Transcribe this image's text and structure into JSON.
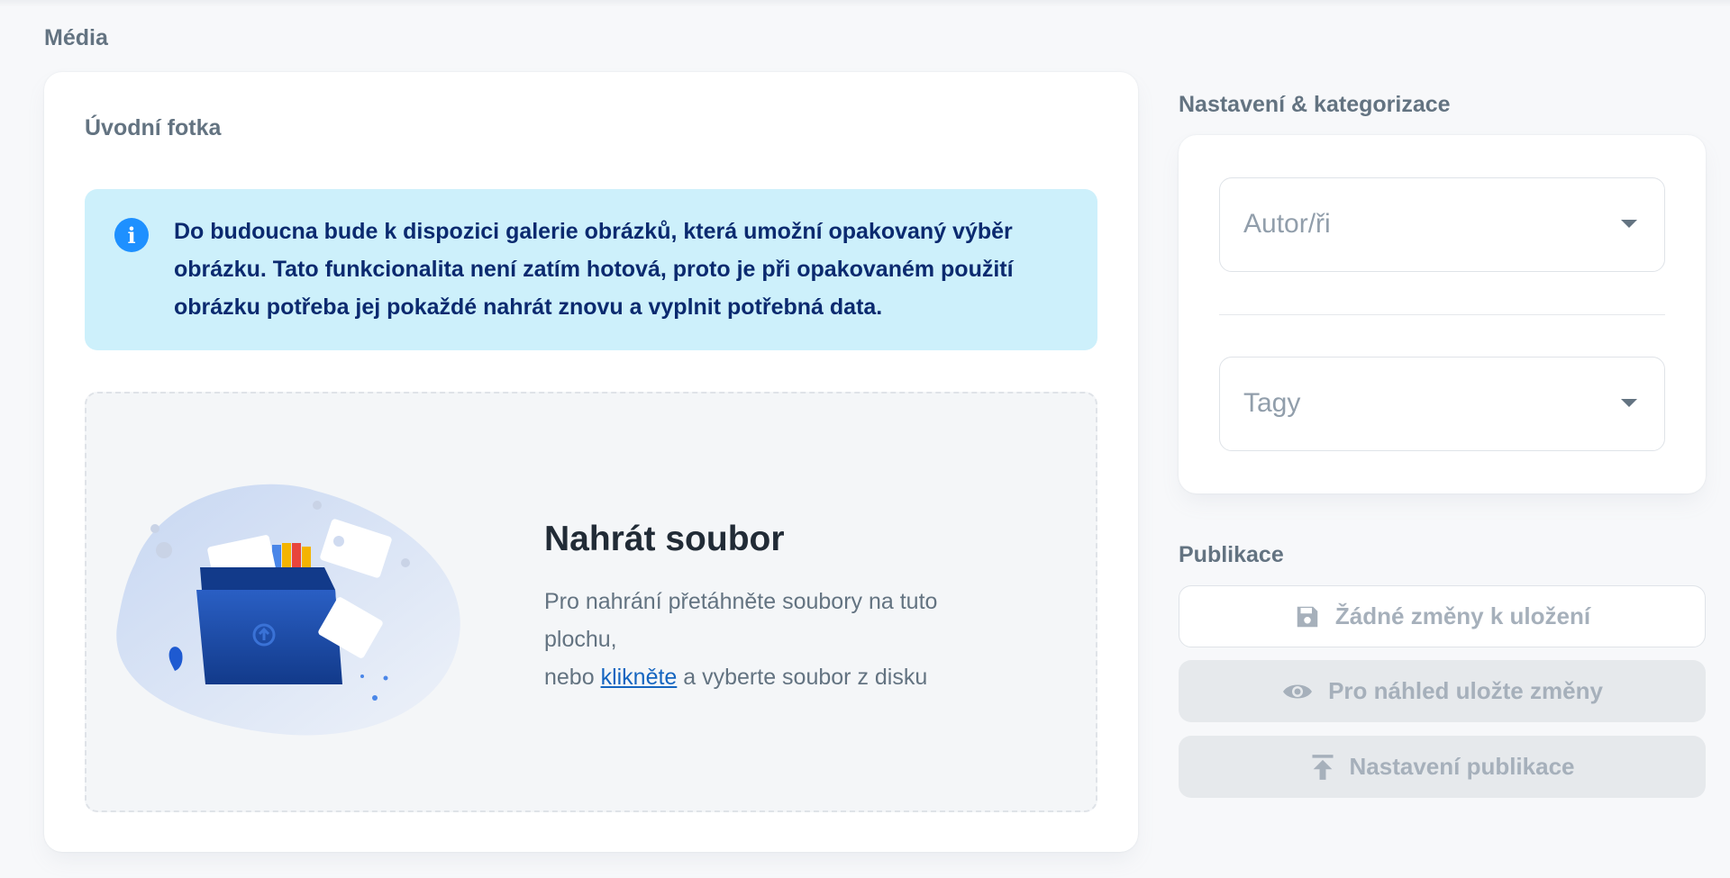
{
  "media": {
    "section_title": "Média",
    "card_title": "Úvodní fotka",
    "alert": {
      "icon": "info-icon",
      "text": "Do budoucna bude k dispozici galerie obrázků, která umožní opakovaný výběr obrázku. Tato funkcionalita není zatím hotová, proto je při opakovaném použití obrázku potřeba jej pokaždé nahrát znovu a vyplnit potřebná data."
    },
    "upload": {
      "title": "Nahrát soubor",
      "desc_line1": "Pro nahrání přetáhněte soubory na tuto plochu,",
      "desc_prefix": "nebo ",
      "link_text": "klikněte",
      "desc_suffix": " a vyberte soubor z disku"
    }
  },
  "settings": {
    "section_title": "Nastavení & kategorizace",
    "authors_placeholder": "Autor/ři",
    "tags_placeholder": "Tagy"
  },
  "publication": {
    "section_title": "Publikace",
    "save_label": "Žádné změny k uložení",
    "preview_label": "Pro náhled uložte změny",
    "publish_label": "Nastavení publikace"
  },
  "colors": {
    "alert_bg": "#cdf0fb",
    "alert_text": "#0b2a6f",
    "info_icon": "#1e90ff",
    "link": "#1565c0",
    "folder": "#1a4fa8"
  }
}
